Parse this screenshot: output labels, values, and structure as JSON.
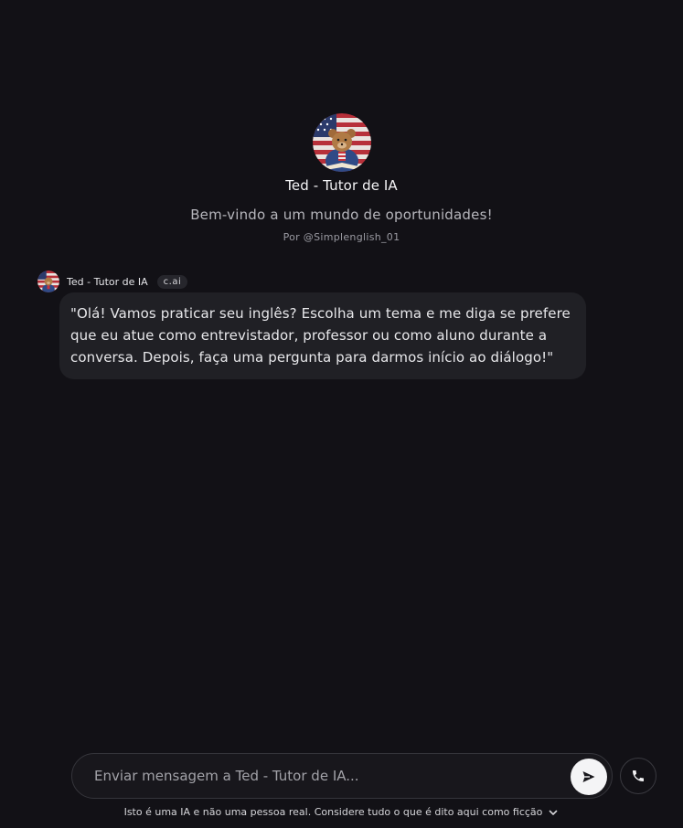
{
  "character": {
    "name": "Ted - Tutor de IA",
    "tagline": "Bem-vindo a um mundo de oportunidades!",
    "author": "Por @Simplenglish_01",
    "avatar_icon": "teddy-bear-american-flag-avatar"
  },
  "message": {
    "author": "Ted - Tutor de IA",
    "badge": "c.ai",
    "text": "\"Olá! Vamos praticar seu inglês? Escolha um tema e me diga se prefere que eu atue como entrevistador, professor ou como aluno durante a conversa. Depois, faça uma pergunta para darmos início ao diálogo!\""
  },
  "composer": {
    "placeholder": "Enviar mensagem a Ted - Tutor de IA...",
    "value": "",
    "send_icon": "send-arrow-icon",
    "call_icon": "phone-icon"
  },
  "disclaimer": {
    "text": "Isto é uma IA e não uma pessoa real. Considere tudo o que é dito aqui como ficção",
    "toggle_icon": "chevron-down-icon"
  },
  "colors": {
    "background": "#121116",
    "bubble": "#202025",
    "send_button": "#f4f4f6"
  }
}
